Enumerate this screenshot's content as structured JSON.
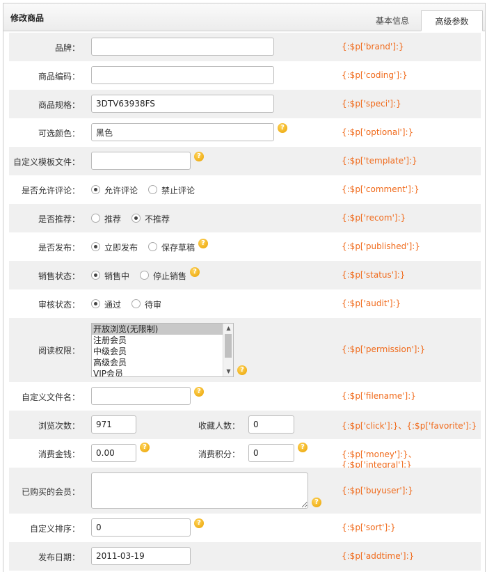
{
  "panel": {
    "title": "修改商品",
    "tabs": [
      "基本信息",
      "高级参数"
    ]
  },
  "fields": {
    "brand": {
      "label": "品牌：",
      "value": "",
      "code": "{:$p['brand']:}"
    },
    "coding": {
      "label": "商品编码：",
      "value": "",
      "code": "{:$p['coding']:}"
    },
    "speci": {
      "label": "商品规格：",
      "value": "3DTV63938FS",
      "code": "{:$p['speci']:}"
    },
    "optional": {
      "label": "可选颜色：",
      "value": "黑色",
      "code": "{:$p['optional']:}"
    },
    "template": {
      "label": "自定义模板文件：",
      "value": "",
      "code": "{:$p['template']:}"
    },
    "comment": {
      "label": "是否允许评论：",
      "options": [
        "允许评论",
        "禁止评论"
      ],
      "selected": 0,
      "code": "{:$p['comment']:}"
    },
    "recom": {
      "label": "是否推荐：",
      "options": [
        "推荐",
        "不推荐"
      ],
      "selected": 1,
      "code": "{:$p['recom']:}"
    },
    "published": {
      "label": "是否发布：",
      "options": [
        "立即发布",
        "保存草稿"
      ],
      "selected": 0,
      "code": "{:$p['published']:}"
    },
    "status": {
      "label": "销售状态：",
      "options": [
        "销售中",
        "停止销售"
      ],
      "selected": 0,
      "code": "{:$p['status']:}"
    },
    "audit": {
      "label": "审核状态：",
      "options": [
        "通过",
        "待审"
      ],
      "selected": 0,
      "code": "{:$p['audit']:}"
    },
    "permission": {
      "label": "阅读权限：",
      "options": [
        "开放浏览(无限制)",
        "注册会员",
        "中级会员",
        "高级会员",
        "VIP会员"
      ],
      "selected": 0,
      "code": "{:$p['permission']:}"
    },
    "filename": {
      "label": "自定义文件名：",
      "value": "",
      "code": "{:$p['filename']:}"
    },
    "click": {
      "label": "浏览次数：",
      "value": "971"
    },
    "favorite": {
      "label": "收藏人数：",
      "value": "0"
    },
    "click_code": "{:$p['click']:}、{:$p['favorite']:}",
    "money": {
      "label": "消费金钱：",
      "value": "0.00"
    },
    "integral": {
      "label": "消费积分：",
      "value": "0"
    },
    "money_code": "{:$p['money']:}、{:$p['integral']:}",
    "buyuser": {
      "label": "已购买的会员：",
      "value": "",
      "code": "{:$p['buyuser']:}"
    },
    "sort": {
      "label": "自定义排序：",
      "value": "0",
      "code": "{:$p['sort']:}"
    },
    "addtime": {
      "label": "发布日期：",
      "value": "2011-03-19",
      "code": "{:$p['addtime']:}"
    }
  },
  "help_glyph": "?",
  "colors": {
    "code": "#f06a1b",
    "help": "#f0ad00",
    "alt_row": "#f0f0f0"
  }
}
